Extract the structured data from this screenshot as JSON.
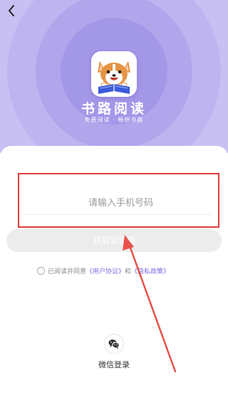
{
  "header": {
    "back_icon": "chevron-left-icon"
  },
  "brand": {
    "name": "书路阅读",
    "slogan": "免费阅读 · 畅想书路",
    "logo_icon": "corgi-reading-book-logo"
  },
  "login": {
    "phone_placeholder": "请输入手机号码",
    "phone_value": "",
    "get_code_label": "获取验证码"
  },
  "agreement": {
    "prefix": "已阅读并同意",
    "user_agreement": "《用户协议》",
    "conjunction": "和",
    "privacy_policy": "《隐私政策》",
    "checked": false
  },
  "social": {
    "wechat_icon": "wechat-icon",
    "wechat_label": "微信登录"
  },
  "annotation": {
    "highlight_color": "#e23c3c",
    "arrow_color": "#e8524a"
  },
  "colors": {
    "hero_bg": "#ccc5f3",
    "accent": "#7c6be0",
    "button_disabled": "#ececec"
  }
}
